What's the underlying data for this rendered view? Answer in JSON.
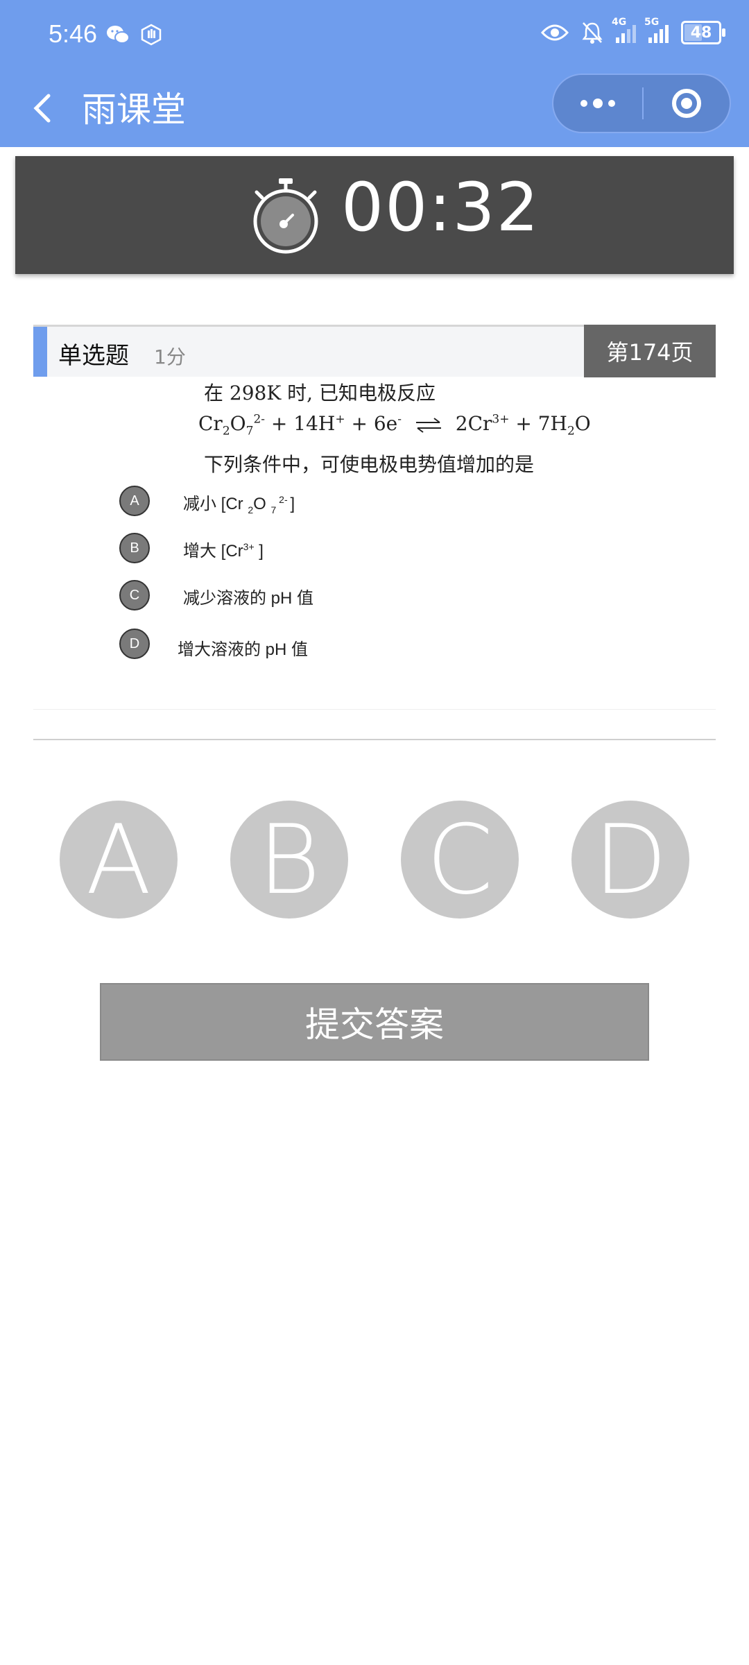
{
  "status_bar": {
    "time": "5:46",
    "left_icons": [
      "wechat-icon",
      "hand-badge-icon"
    ],
    "right_icons": [
      "eye-icon",
      "bell-muted-icon",
      "signal-4g-icon",
      "signal-5g-icon",
      "battery-icon"
    ],
    "signal_1_label": "4G",
    "signal_2_label": "5G",
    "battery": "48"
  },
  "title_bar": {
    "title": "雨课堂",
    "back_icon": "chevron-left-icon",
    "more_icon": "more-dots-icon",
    "close_icon": "target-circle-icon"
  },
  "timer": {
    "icon": "stopwatch-icon",
    "value": "00:32"
  },
  "question": {
    "type": "单选题",
    "score": "1分",
    "page": "第174页",
    "line1": "在 298K 时, 已知电极反应",
    "eq_left": {
      "a": "Cr",
      "b": "2",
      "c": "O",
      "d": "7",
      "e": "2-",
      "f": " + 14H",
      "g": "+",
      "h": " + 6e",
      "i": "-"
    },
    "eq_right": {
      "a": "2Cr",
      "b": "3+",
      "c": " + 7H",
      "d": "2",
      "e": "O"
    },
    "line3": "下列条件中，可使电极电势值增加的是",
    "options": [
      {
        "letter": "A",
        "t1": "减小 [Cr ",
        "t2": "2",
        "t3": "O ",
        "t4": "7",
        "t5": " 2- ",
        "t6": "]"
      },
      {
        "letter": "B",
        "t1": "增大 [Cr",
        "t2": "3+",
        "t3": " ]"
      },
      {
        "letter": "C",
        "t1": "减少溶液的 pH 值"
      },
      {
        "letter": "D",
        "t1": "增大溶液的 pH 值"
      }
    ]
  },
  "choices": [
    "A",
    "B",
    "C",
    "D"
  ],
  "submit_label": "提交答案",
  "colors": {
    "header": "#6f9ded",
    "timer_bg": "#4a4a4a",
    "choice": "#c8c8c8",
    "submit": "#999999"
  }
}
